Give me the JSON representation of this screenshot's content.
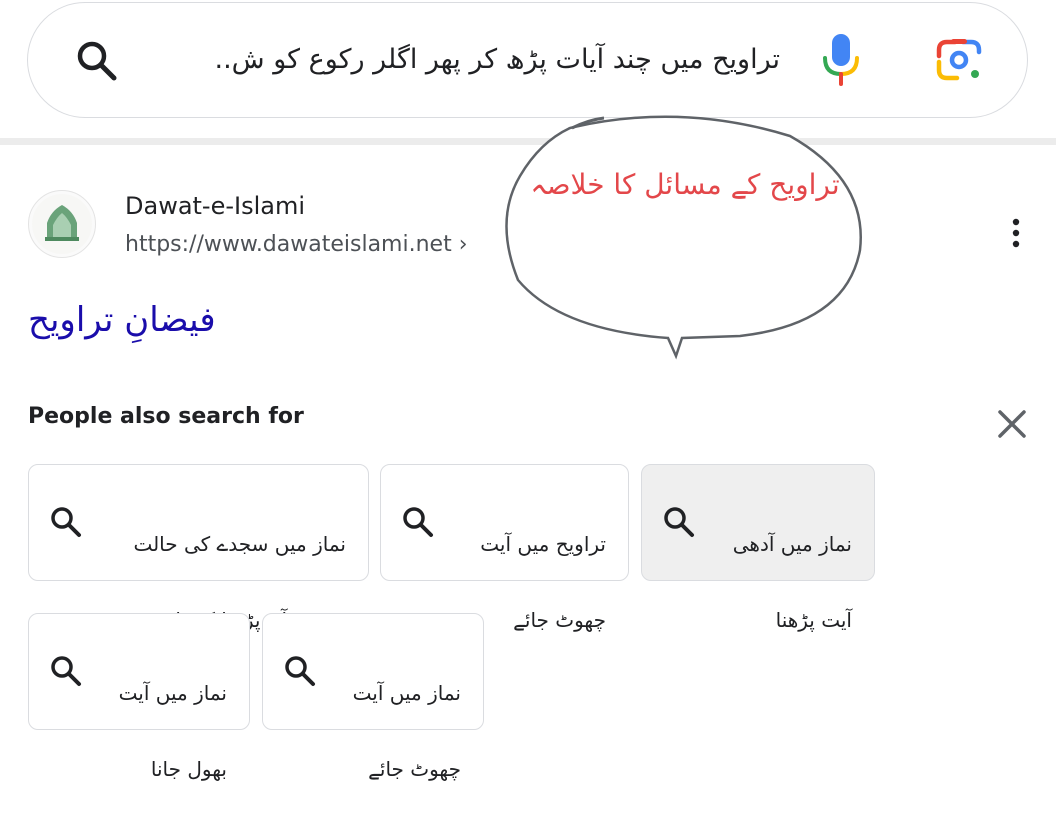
{
  "search": {
    "query": "تراویح میں چند آیات پڑھ کر پھر اگلر رکوع کو ش.."
  },
  "result": {
    "site_name": "Dawat-e-Islami",
    "site_url": "https://www.dawateislami.net ›",
    "title": "فیضانِ تراویح"
  },
  "bubble": {
    "line1": "تراویح کے مسائل",
    "line2": "کا خلاصہ",
    "color": "#e3474a"
  },
  "people_also_search": {
    "heading": "People also search for",
    "chips": [
      {
        "line1": "نماز میں سجدے کی حالت",
        "line2": "میں قرآن پڑھنا کیسا ہے"
      },
      {
        "line1": "تراویح میں آیت",
        "line2": "چھوٹ جائے"
      },
      {
        "line1": "نماز میں آدھی",
        "line2": "آیت پڑھنا"
      },
      {
        "line1": "نماز میں آیت",
        "line2": "بھول جانا"
      },
      {
        "line1": "نماز میں آیت",
        "line2": "چھوٹ جائے"
      }
    ]
  },
  "icons": {
    "search": "search-icon",
    "mic": "mic-icon",
    "lens": "google-lens-icon",
    "more": "more-vert-icon",
    "close": "close-icon"
  },
  "colors": {
    "link": "#1a0dab",
    "google_blue": "#4285F4",
    "google_red": "#EA4335",
    "google_yellow": "#FBBC05",
    "google_green": "#34A853"
  }
}
